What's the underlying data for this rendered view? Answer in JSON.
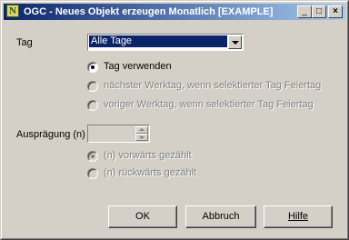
{
  "window": {
    "title": "OGC - Neues Objekt erzeugen Monatlich [EXAMPLE]",
    "app_icon_letter": "N",
    "minimize_glyph": "_",
    "maximize_glyph": "□",
    "close_glyph": "×"
  },
  "tag": {
    "label": "Tag",
    "selected": "Alle Tage"
  },
  "radios": [
    {
      "label": "Tag verwenden",
      "checked": true,
      "enabled": true
    },
    {
      "label": "nächster Werktag, wenn selektierter Tag Feiertag",
      "checked": false,
      "enabled": false
    },
    {
      "label": "voriger Werktag, wenn selektierter Tag Feiertag",
      "checked": false,
      "enabled": false
    }
  ],
  "auspraegung": {
    "label": "Ausprägung (n)",
    "value": ""
  },
  "direction": [
    {
      "label": "(n) vorwärts gezählt",
      "checked": true,
      "enabled": false
    },
    {
      "label": "(n) rückwärts gezählt",
      "checked": false,
      "enabled": false
    }
  ],
  "buttons": {
    "ok": "OK",
    "cancel": "Abbruch",
    "help": "Hilfe"
  }
}
